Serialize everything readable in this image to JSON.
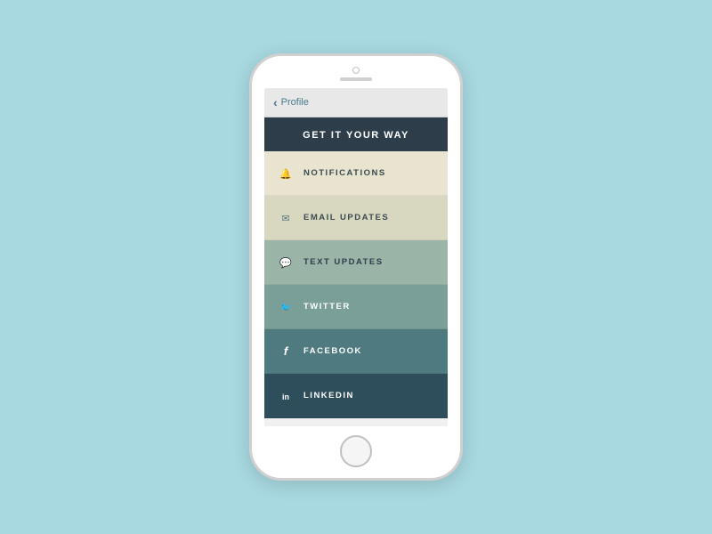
{
  "phone": {
    "nav": {
      "back_label": "Profile",
      "back_chevron": "‹"
    },
    "header": {
      "title": "GET IT YOUR WAY"
    },
    "menu_items": [
      {
        "id": "notifications",
        "label": "NOTIFICATIONS",
        "icon": "bell",
        "css_class": "menu-item-notifications",
        "icon_class": "icon-bell"
      },
      {
        "id": "email",
        "label": "EMAIL UPDATES",
        "icon": "email",
        "css_class": "menu-item-email",
        "icon_class": "icon-email"
      },
      {
        "id": "text",
        "label": "TEXT UPDATES",
        "icon": "chat",
        "css_class": "menu-item-text",
        "icon_class": "icon-chat"
      },
      {
        "id": "twitter",
        "label": "TWITTER",
        "icon": "twitter",
        "css_class": "menu-item-twitter",
        "icon_class": "icon-twitter"
      },
      {
        "id": "facebook",
        "label": "FACEBOOK",
        "icon": "facebook",
        "css_class": "menu-item-facebook",
        "icon_class": "icon-facebook"
      },
      {
        "id": "linkedin",
        "label": "LINKEDIN",
        "icon": "linkedin",
        "css_class": "menu-item-linkedin",
        "icon_class": "icon-linkedin"
      }
    ]
  }
}
